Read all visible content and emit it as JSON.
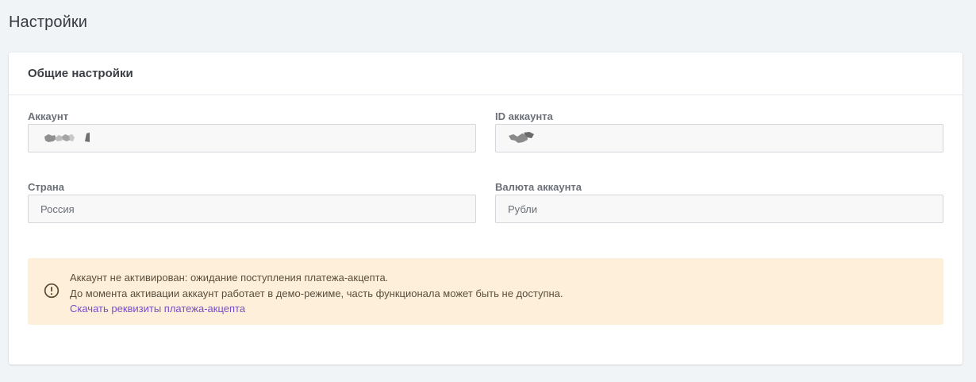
{
  "page": {
    "title": "Настройки"
  },
  "general_settings": {
    "title": "Общие настройки",
    "fields": {
      "account": {
        "label": "Аккаунт",
        "value": ""
      },
      "account_id": {
        "label": "ID аккаунта",
        "value": ""
      },
      "country": {
        "label": "Страна",
        "value": "Россия"
      },
      "currency": {
        "label": "Валюта аккаунта",
        "value": "Рубли"
      }
    }
  },
  "alert": {
    "icon": "exclamation-circle-icon",
    "line1": "Аккаунт не активирован: ожидание поступления платежа-акцепта.",
    "line2": "До момента активации аккаунт работает в демо-режиме, часть функционала может быть не доступна.",
    "link_label": "Скачать реквизиты платежа-акцепта"
  },
  "colors": {
    "page_background": "#f1f4f7",
    "card_background": "#ffffff",
    "alert_background": "#fdefda",
    "link": "#7b4cc7"
  }
}
